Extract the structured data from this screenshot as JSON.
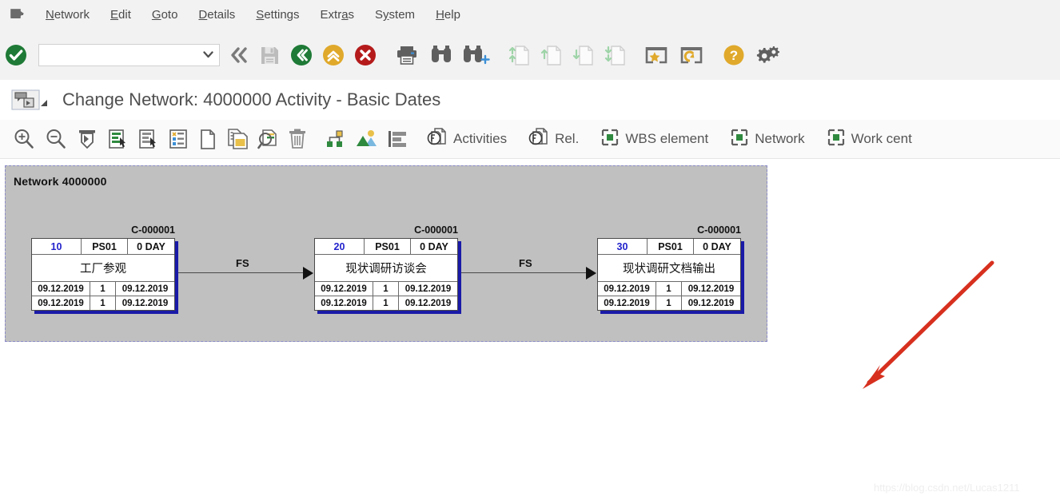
{
  "menubar": {
    "system_icon": "sap-system-menu-icon",
    "items": [
      {
        "label": "Network",
        "mnemonic": "N"
      },
      {
        "label": "Edit",
        "mnemonic": "E"
      },
      {
        "label": "Goto",
        "mnemonic": "G"
      },
      {
        "label": "Details",
        "mnemonic": "D"
      },
      {
        "label": "Settings",
        "mnemonic": "S"
      },
      {
        "label": "Extras",
        "mnemonic": "a"
      },
      {
        "label": "System",
        "mnemonic": "y"
      },
      {
        "label": "Help",
        "mnemonic": "H"
      }
    ]
  },
  "toolbar": {
    "enter_label": "Enter",
    "command_value": "",
    "command_placeholder": "",
    "buttons": [
      {
        "name": "enter-button",
        "icon": "green-check-icon",
        "enabled": true
      },
      {
        "name": "back-fast-button",
        "icon": "double-chevron-left-icon",
        "enabled": true
      },
      {
        "name": "save-button",
        "icon": "save-disk-icon",
        "enabled": false
      },
      {
        "name": "back-button",
        "icon": "green-back-icon",
        "enabled": true
      },
      {
        "name": "exit-button",
        "icon": "yellow-up-icon",
        "enabled": true
      },
      {
        "name": "cancel-button",
        "icon": "red-cancel-icon",
        "enabled": true
      },
      {
        "name": "print-button",
        "icon": "printer-icon",
        "enabled": true
      },
      {
        "name": "find-button",
        "icon": "binoculars-icon",
        "enabled": true
      },
      {
        "name": "find-next-button",
        "icon": "binoculars-plus-icon",
        "enabled": true
      },
      {
        "name": "first-page-button",
        "icon": "page-first-icon",
        "enabled": false
      },
      {
        "name": "previous-page-button",
        "icon": "page-up-icon",
        "enabled": false
      },
      {
        "name": "next-page-button",
        "icon": "page-down-icon",
        "enabled": false
      },
      {
        "name": "last-page-button",
        "icon": "page-last-icon",
        "enabled": false
      },
      {
        "name": "create-shortcut-button",
        "icon": "star-window-icon",
        "enabled": true
      },
      {
        "name": "create-session-button",
        "icon": "refresh-window-icon",
        "enabled": true
      },
      {
        "name": "help-button",
        "icon": "yellow-question-icon",
        "enabled": true
      },
      {
        "name": "customize-button",
        "icon": "gears-icon",
        "enabled": true
      }
    ]
  },
  "title": {
    "icon": "window-variant-icon",
    "text": "Change Network: 4000000 Activity - Basic Dates"
  },
  "apptoolbar": {
    "buttons": [
      {
        "name": "zoom-in-button",
        "icon": "zoom-in-icon",
        "label": ""
      },
      {
        "name": "zoom-out-button",
        "icon": "zoom-out-icon",
        "label": ""
      },
      {
        "name": "fit-to-page-button",
        "icon": "fit-page-icon",
        "label": ""
      },
      {
        "name": "select-green-button",
        "icon": "select-list-green-icon",
        "label": ""
      },
      {
        "name": "select-grey-button",
        "icon": "select-list-grey-icon",
        "label": ""
      },
      {
        "name": "field-selection-button",
        "icon": "field-list-icon",
        "label": ""
      },
      {
        "name": "new-object-button",
        "icon": "blank-page-icon",
        "label": ""
      },
      {
        "name": "copy-object-button",
        "icon": "copy-page-icon",
        "label": ""
      },
      {
        "name": "find-object-button",
        "icon": "page-search-icon",
        "label": ""
      },
      {
        "name": "delete-object-button",
        "icon": "trash-icon",
        "label": ""
      },
      {
        "name": "network-structure-button",
        "icon": "network-nodes-icon",
        "label": ""
      },
      {
        "name": "graphic-button",
        "icon": "mountains-icon",
        "label": ""
      },
      {
        "name": "outline-button",
        "icon": "outline-bars-icon",
        "label": ""
      },
      {
        "name": "activities-button",
        "icon": "overview-pages-icon",
        "label": "Activities"
      },
      {
        "name": "relationships-button",
        "icon": "overview-pages-icon",
        "label": "Rel."
      },
      {
        "name": "wbs-element-button",
        "icon": "green-square-window-icon",
        "label": "WBS element"
      },
      {
        "name": "network-button",
        "icon": "green-square-window-icon",
        "label": "Network"
      },
      {
        "name": "work-center-button",
        "icon": "green-square-window-icon",
        "label": "Work cent"
      }
    ]
  },
  "diagram": {
    "network_label": "Network 4000000",
    "nodes": [
      {
        "wbs": "C-000001",
        "activity_number": "10",
        "work_center": "PS01",
        "duration": "0 DAY",
        "description": "工厂参观",
        "early_start": "09.12.2019",
        "early_duration": "1",
        "early_finish": "09.12.2019",
        "late_start": "09.12.2019",
        "late_duration": "1",
        "late_finish": "09.12.2019"
      },
      {
        "wbs": "C-000001",
        "activity_number": "20",
        "work_center": "PS01",
        "duration": "0 DAY",
        "description": "现状调研访谈会",
        "early_start": "09.12.2019",
        "early_duration": "1",
        "early_finish": "09.12.2019",
        "late_start": "09.12.2019",
        "late_duration": "1",
        "late_finish": "09.12.2019"
      },
      {
        "wbs": "C-000001",
        "activity_number": "30",
        "work_center": "PS01",
        "duration": "0 DAY",
        "description": "现状调研文档输出",
        "early_start": "09.12.2019",
        "early_duration": "1",
        "early_finish": "09.12.2019",
        "late_start": "09.12.2019",
        "late_duration": "1",
        "late_finish": "09.12.2019"
      }
    ],
    "links": [
      {
        "type": "FS",
        "from": "10",
        "to": "20"
      },
      {
        "type": "FS",
        "from": "20",
        "to": "30"
      }
    ]
  },
  "annotation": {
    "name": "red-arrow-annotation",
    "color": "#d7301f"
  },
  "watermark": {
    "text": "https://blog.csdn.net/Lucas1211"
  }
}
